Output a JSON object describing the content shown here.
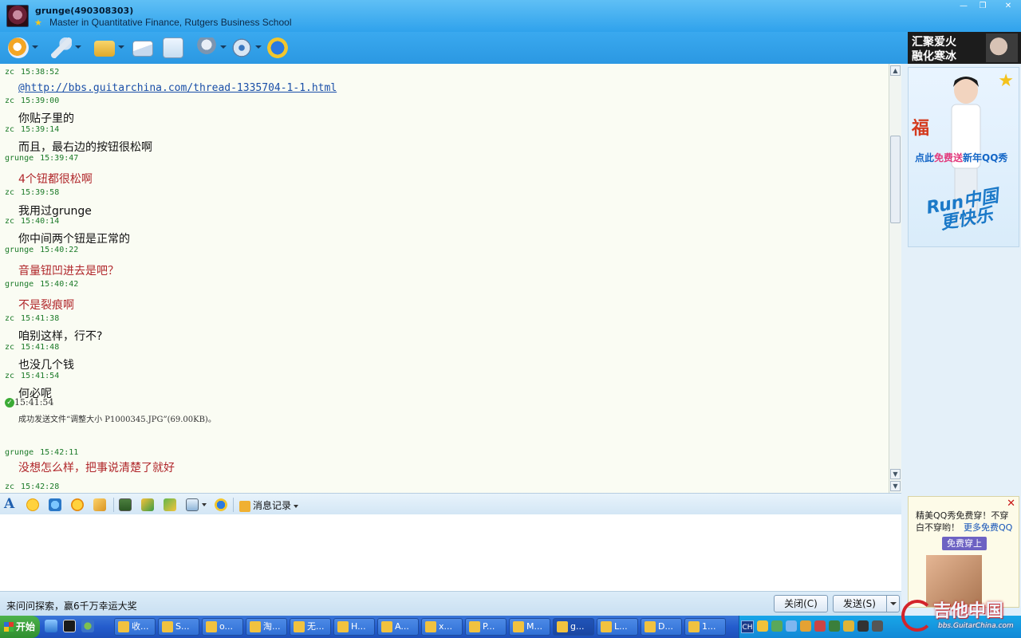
{
  "window": {
    "contact_name": "grunge(490308303)",
    "contact_signature": "Master in Quantitative Finance, Rutgers Business School",
    "minimize": "—",
    "maximize": "❐",
    "close": "✕"
  },
  "toolbar": {
    "icons": [
      "video-chat-icon",
      "voice-chat-icon",
      "send-file-icon",
      "send-email-icon",
      "create-group-icon",
      "apps-icon",
      "settings-icon",
      "soso-icon"
    ]
  },
  "ads": {
    "top_line1": "汇聚爱火",
    "top_line2": "融化寒冰",
    "main_promo_prefix": "点此",
    "main_promo_highlight": "免费送",
    "main_promo_suffix": "新年QQ秀",
    "main_run_line1": "Run中国",
    "main_run_line2": "更快乐",
    "main_fu": "福",
    "bottom_text": "精美QQ秀免费穿！不穿白不穿哟！",
    "bottom_link": "更多免费QQ",
    "bottom_button": "免费穿上",
    "bottom_close": "✕"
  },
  "chat": {
    "messages": [
      {
        "sender": "zc",
        "time": "15:38:52",
        "text": "@http://bbs.guitarchina.com/thread-1335704-1-1.html",
        "style": "link"
      },
      {
        "sender": "zc",
        "time": "15:39:00",
        "text": "你贴子里的",
        "style": "zc"
      },
      {
        "sender": "zc",
        "time": "15:39:14",
        "text": "而且，最右边的按钮很松啊",
        "style": "zc"
      },
      {
        "sender": "grunge",
        "time": "15:39:47",
        "text": "4个钮都很松啊",
        "style": "me"
      },
      {
        "sender": "zc",
        "time": "15:39:58",
        "text": "我用过grunge",
        "style": "zc"
      },
      {
        "sender": "zc",
        "time": "15:40:14",
        "text": "你中间两个钮是正常的",
        "style": "zc"
      },
      {
        "sender": "grunge",
        "time": "15:40:22",
        "text": "音量钮凹进去是吧？",
        "style": "me"
      },
      {
        "sender": "grunge",
        "time": "15:40:42",
        "text": "不是裂痕啊",
        "style": "me"
      },
      {
        "sender": "zc",
        "time": "15:41:38",
        "text": "咱别这样，行不?",
        "style": "zc"
      },
      {
        "sender": "zc",
        "time": "15:41:48",
        "text": "也没几个钱",
        "style": "zc"
      },
      {
        "sender": "zc",
        "time": "15:41:54",
        "text": "何必呢",
        "style": "zc"
      }
    ],
    "system": {
      "time": "15:41:54",
      "text": "成功发送文件“调整大小 P1000345.JPG”(69.00KB)。"
    },
    "after": [
      {
        "sender": "grunge",
        "time": "15:42:11",
        "text": "没想怎么样，把事说清楚了就好",
        "style": "me"
      },
      {
        "sender": "zc",
        "time": "15:42:28",
        "text": "",
        "style": "zc"
      }
    ]
  },
  "input_toolbar": {
    "font": "A",
    "history": "消息记录",
    "icons": [
      "emoticon-icon",
      "magic-emoticon-icon",
      "nudge-icon",
      "scribble-icon",
      "screenshot-icon",
      "music-icon",
      "image-icon",
      "send-picture-icon",
      "soso-icon"
    ]
  },
  "bottom": {
    "ad_text": "来问问探索，赢6千万幸运大奖",
    "close_button": "关闭(C)",
    "send_button": "发送(S)"
  },
  "taskbar": {
    "start": "开始",
    "tasks": [
      "收...",
      "S...",
      "o...",
      "淘...",
      "无...",
      "H...",
      "A...",
      "x...",
      "P...",
      "M...",
      "g...",
      "L...",
      "D...",
      "1..."
    ],
    "active_index": 10,
    "lang": "CH"
  },
  "watermark": {
    "title": "吉他中国",
    "url": "bbs.GuitarChina.com"
  }
}
